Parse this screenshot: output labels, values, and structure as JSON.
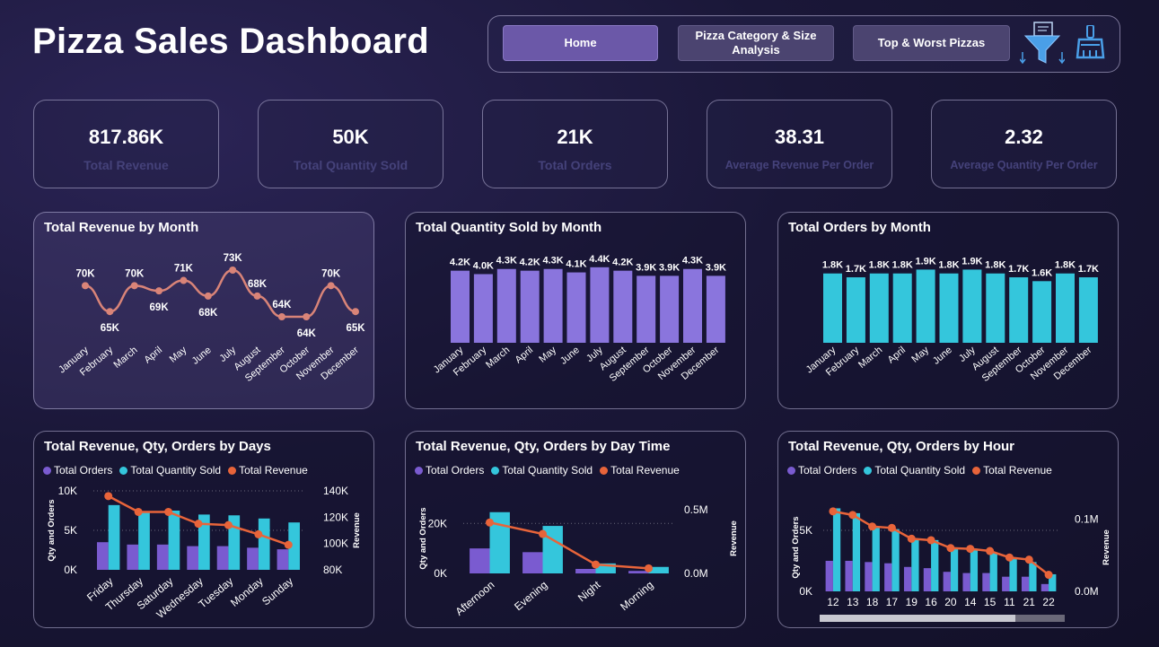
{
  "title": "Pizza Sales Dashboard",
  "nav": {
    "home": "Home",
    "category": "Pizza Category & Size Analysis",
    "topworst": "Top & Worst Pizzas",
    "filter_icon": "filter-funnel-icon",
    "clear_icon": "eraser-broom-icon"
  },
  "kpis": [
    {
      "value": "817.86K",
      "label": "Total Revenue"
    },
    {
      "value": "50K",
      "label": "Total Quantity Sold"
    },
    {
      "value": "21K",
      "label": "Total Orders"
    },
    {
      "value": "38.31",
      "label": "Average Revenue Per Order"
    },
    {
      "value": "2.32",
      "label": "Average Quantity Per Order"
    }
  ],
  "colors": {
    "orders": "#7a5bd0",
    "qty": "#34c6dc",
    "revenue": "#e8643a",
    "revenue_line": "#d98478",
    "qty_bar": "#8a75dd"
  },
  "chart_data": [
    {
      "type": "line",
      "title": "Total Revenue by Month",
      "categories": [
        "January",
        "February",
        "March",
        "April",
        "May",
        "June",
        "July",
        "August",
        "September",
        "October",
        "November",
        "December"
      ],
      "values": [
        70,
        65,
        70,
        69,
        71,
        68,
        73,
        68,
        64,
        64,
        70,
        65
      ],
      "labels": [
        "70K",
        "65K",
        "70K",
        "69K",
        "71K",
        "68K",
        "73K",
        "68K",
        "64K",
        "64K",
        "70K",
        "65K"
      ]
    },
    {
      "type": "bar",
      "title": "Total Quantity Sold by Month",
      "categories": [
        "January",
        "February",
        "March",
        "April",
        "May",
        "June",
        "July",
        "August",
        "September",
        "October",
        "November",
        "December"
      ],
      "values": [
        4.2,
        4.0,
        4.3,
        4.2,
        4.3,
        4.1,
        4.4,
        4.2,
        3.9,
        3.9,
        4.3,
        3.9
      ],
      "labels": [
        "4.2K",
        "4.0K",
        "4.3K",
        "4.2K",
        "4.3K",
        "4.1K",
        "4.4K",
        "4.2K",
        "3.9K",
        "3.9K",
        "4.3K",
        "3.9K"
      ]
    },
    {
      "type": "bar",
      "title": "Total Orders by Month",
      "categories": [
        "January",
        "February",
        "March",
        "April",
        "May",
        "June",
        "July",
        "August",
        "September",
        "October",
        "November",
        "December"
      ],
      "values": [
        1.8,
        1.7,
        1.8,
        1.8,
        1.9,
        1.8,
        1.9,
        1.8,
        1.7,
        1.6,
        1.8,
        1.7
      ],
      "labels": [
        "1.8K",
        "1.7K",
        "1.8K",
        "1.8K",
        "1.9K",
        "1.8K",
        "1.9K",
        "1.8K",
        "1.7K",
        "1.6K",
        "1.8K",
        "1.7K"
      ]
    },
    {
      "type": "bar",
      "title": "Total Revenue, Qty, Orders by Days",
      "legend": [
        "Total Orders",
        "Total Quantity Sold",
        "Total Revenue"
      ],
      "categories": [
        "Friday",
        "Thursday",
        "Saturday",
        "Wednesday",
        "Tuesday",
        "Monday",
        "Sunday"
      ],
      "series": [
        {
          "name": "Total Orders",
          "values": [
            3.5,
            3.2,
            3.2,
            3.0,
            3.0,
            2.8,
            2.6
          ]
        },
        {
          "name": "Total Quantity Sold",
          "values": [
            8.2,
            7.4,
            7.5,
            7.0,
            6.9,
            6.5,
            6.0
          ]
        },
        {
          "name": "Total Revenue",
          "values": [
            136,
            124,
            124,
            115,
            114,
            107,
            99
          ]
        }
      ],
      "ylabel": "Qty and Orders",
      "y2label": "Revenue",
      "yticks": [
        "0K",
        "5K",
        "10K"
      ],
      "y2ticks": [
        "80K",
        "100K",
        "120K",
        "140K"
      ],
      "ylim": [
        0,
        10
      ],
      "y2lim": [
        80,
        140
      ]
    },
    {
      "type": "bar",
      "title": "Total Revenue, Qty, Orders by Day Time",
      "legend": [
        "Total Orders",
        "Total Quantity Sold",
        "Total Revenue"
      ],
      "categories": [
        "Afternoon",
        "Evening",
        "Night",
        "Morning"
      ],
      "series": [
        {
          "name": "Total Orders",
          "values": [
            10,
            8.5,
            1.8,
            1.0
          ]
        },
        {
          "name": "Total Quantity Sold",
          "values": [
            24.5,
            19,
            4.0,
            2.6
          ]
        },
        {
          "name": "Total Revenue",
          "values": [
            0.4,
            0.31,
            0.07,
            0.04
          ]
        }
      ],
      "ylabel": "Qty and Orders",
      "y2label": "Revenue",
      "yticks": [
        "0K",
        "20K"
      ],
      "y2ticks": [
        "0.0M",
        "0.5M"
      ],
      "ylim": [
        0,
        28
      ],
      "y2lim": [
        0,
        0.55
      ]
    },
    {
      "type": "bar",
      "title": "Total Revenue, Qty, Orders by Hour",
      "legend": [
        "Total Orders",
        "Total Quantity Sold",
        "Total Revenue"
      ],
      "categories": [
        "12",
        "13",
        "18",
        "17",
        "19",
        "16",
        "20",
        "14",
        "15",
        "11",
        "21",
        "22"
      ],
      "series": [
        {
          "name": "Total Orders",
          "values": [
            2.5,
            2.5,
            2.4,
            2.3,
            2.0,
            1.9,
            1.6,
            1.5,
            1.5,
            1.2,
            1.2,
            0.6
          ]
        },
        {
          "name": "Total Quantity Sold",
          "values": [
            6.8,
            6.4,
            5.2,
            5.1,
            4.2,
            4.2,
            3.5,
            3.5,
            3.2,
            2.7,
            2.4,
            1.4
          ]
        },
        {
          "name": "Total Revenue",
          "values": [
            0.111,
            0.106,
            0.09,
            0.088,
            0.073,
            0.071,
            0.06,
            0.059,
            0.056,
            0.047,
            0.044,
            0.023
          ]
        }
      ],
      "ylabel": "Qty and Orders",
      "y2label": "Revenue",
      "yticks": [
        "0K",
        "5K"
      ],
      "y2ticks": [
        "0.0M",
        "0.1M"
      ],
      "ylim": [
        0,
        7.2
      ],
      "y2lim": [
        0,
        0.122
      ]
    }
  ]
}
